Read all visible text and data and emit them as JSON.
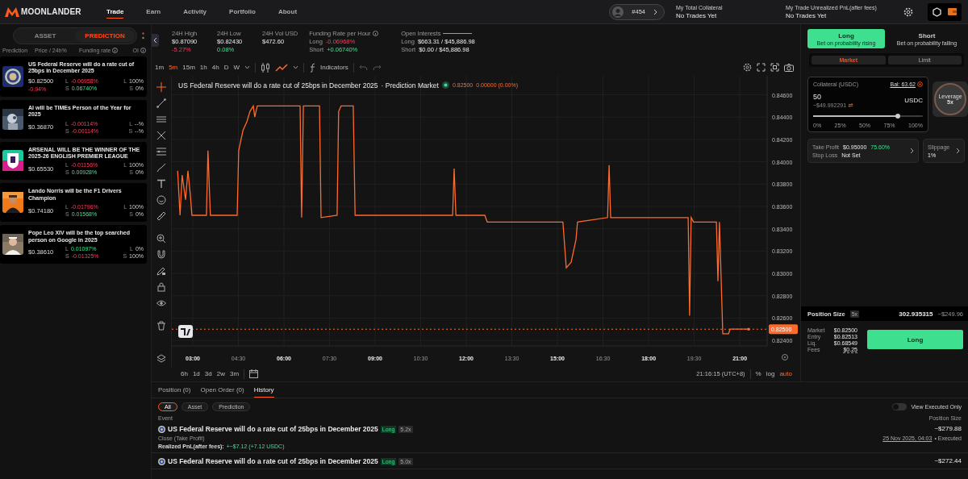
{
  "nav": {
    "logo": "MOONLANDER",
    "links": [
      {
        "label": "Trade",
        "selected": true
      },
      {
        "label": "Earn",
        "selected": false
      },
      {
        "label": "Activity",
        "selected": false
      },
      {
        "label": "Portfolio",
        "selected": false
      },
      {
        "label": "About",
        "selected": false
      }
    ]
  },
  "account": {
    "rank": "#454"
  },
  "summary": [
    {
      "label": "My Total Collateral",
      "value": "No Trades Yet"
    },
    {
      "label": "My Trade Unrealized PnL(after fees)",
      "value": "No Trades Yet"
    }
  ],
  "sidebar": {
    "tabs": [
      {
        "label": "ASSET",
        "selected": false
      },
      {
        "label": "PREDICTION",
        "selected": true
      }
    ],
    "columns": [
      {
        "label": "Prediction",
        "info": false
      },
      {
        "label": "Price / 24h%",
        "info": false
      },
      {
        "label": "Funding rate",
        "info": true
      },
      {
        "label": "OI",
        "info": true
      }
    ],
    "markets": [
      {
        "title": "US Federal Reserve will do a rate cut of 25bps in December 2025",
        "price": "$0.82500",
        "change": {
          "text": "-0.94%",
          "up": false
        },
        "rates": [
          {
            "side": "L",
            "value": "-0.06958%",
            "up": false
          },
          {
            "side": "S",
            "value": "0.06740%",
            "up": true
          }
        ],
        "oi": [
          {
            "side": "L",
            "value": "100%"
          },
          {
            "side": "S",
            "value": "0%"
          }
        ]
      },
      {
        "title": "AI will be TIMEs Person of the Year for 2025",
        "price": "$0.36870",
        "rates": [
          {
            "side": "L",
            "value": "-0.00114%",
            "up": false
          },
          {
            "side": "S",
            "value": "-0.00114%",
            "up": false
          }
        ],
        "oi": [
          {
            "side": "L",
            "value": "--%"
          },
          {
            "side": "S",
            "value": "--%"
          }
        ]
      },
      {
        "title": "ARSENAL WILL BE THE WINNER OF THE 2025-26 ENGLISH PREMIER LEAGUE",
        "price": "$0.65530",
        "rates": [
          {
            "side": "L",
            "value": "-0.01156%",
            "up": false
          },
          {
            "side": "S",
            "value": "0.00928%",
            "up": true
          }
        ],
        "oi": [
          {
            "side": "L",
            "value": "100%"
          },
          {
            "side": "S",
            "value": "0%"
          }
        ]
      },
      {
        "title": "Lando Norris will be the F1 Drivers Champion",
        "price": "$0.74180",
        "rates": [
          {
            "side": "L",
            "value": "-0.01796%",
            "up": false
          },
          {
            "side": "S",
            "value": "0.01568%",
            "up": true
          }
        ],
        "oi": [
          {
            "side": "L",
            "value": "100%"
          },
          {
            "side": "S",
            "value": "0%"
          }
        ]
      },
      {
        "title": "Pope Leo XIV will be the top searched person on Google in 2025",
        "price": "$0.38610",
        "rates": [
          {
            "side": "L",
            "value": "0.01097%",
            "up": true
          },
          {
            "side": "S",
            "value": "-0.01325%",
            "up": false
          }
        ],
        "oi": [
          {
            "side": "L",
            "value": "0%"
          },
          {
            "side": "S",
            "value": "100%"
          }
        ]
      }
    ]
  },
  "stats": [
    {
      "label": "24H High",
      "value": "$0.87090",
      "change": {
        "text": "-5.27%",
        "up": false
      }
    },
    {
      "label": "24H Low",
      "value": "$0.82430",
      "change": {
        "text": "0.08%",
        "up": true
      }
    },
    {
      "label": "24H Vol USD",
      "value": "$472.60"
    }
  ],
  "funding": {
    "label": "Funding Rate per Hour",
    "rows": [
      {
        "side": "Long",
        "value": "-0.06968%",
        "up": false
      },
      {
        "side": "Short",
        "value": "+0.06740%",
        "up": true
      }
    ]
  },
  "open_interest": {
    "label": "Open Interests",
    "level": 1,
    "rows": [
      {
        "side": "Long",
        "value": "$663.31 / $45,886.98"
      },
      {
        "side": "Short",
        "value": "$0.00 / $45,886.98"
      }
    ]
  },
  "intervals": [
    {
      "label": "1m",
      "selected": false
    },
    {
      "label": "5m",
      "selected": true
    },
    {
      "label": "15m",
      "selected": false
    },
    {
      "label": "1h",
      "selected": false
    },
    {
      "label": "4h",
      "selected": false
    },
    {
      "label": "D",
      "selected": false
    },
    {
      "label": "W",
      "selected": false
    }
  ],
  "indicators_label": "Indicators",
  "chart": {
    "title": "US Federal Reserve will do a rate cut of 25bps in December 2025",
    "subtitle": "· Prediction Market",
    "price": "0.82500",
    "change": "0.00000 (0.00%)",
    "chart_data": {
      "type": "line",
      "grid": true,
      "xlim": [
        2.31,
        21.9
      ],
      "ylim": [
        0.8235,
        0.8477
      ],
      "xticks": [
        {
          "value": 3,
          "label": "03:00"
        },
        {
          "value": 4.5,
          "label": "04:30"
        },
        {
          "value": 6,
          "label": "06:00"
        },
        {
          "value": 7.5,
          "label": "07:30"
        },
        {
          "value": 9,
          "label": "09:00"
        },
        {
          "value": 10.5,
          "label": "10:30"
        },
        {
          "value": 12,
          "label": "12:00"
        },
        {
          "value": 13.5,
          "label": "13:30"
        },
        {
          "value": 15,
          "label": "15:00"
        },
        {
          "value": 16.5,
          "label": "16:30"
        },
        {
          "value": 18,
          "label": "18:00"
        },
        {
          "value": 19.5,
          "label": "19:30"
        },
        {
          "value": 21,
          "label": "21:00"
        }
      ],
      "yticks": [
        {
          "value": 0.824,
          "label": "0.82400"
        },
        {
          "value": 0.826,
          "label": "0.82600"
        },
        {
          "value": 0.828,
          "label": "0.82800"
        },
        {
          "value": 0.83,
          "label": "0.83000"
        },
        {
          "value": 0.832,
          "label": "0.83200"
        },
        {
          "value": 0.834,
          "label": "0.83400"
        },
        {
          "value": 0.836,
          "label": "0.83600"
        },
        {
          "value": 0.838,
          "label": "0.83800"
        },
        {
          "value": 0.84,
          "label": "0.84000"
        },
        {
          "value": 0.842,
          "label": "0.84200"
        },
        {
          "value": 0.844,
          "label": "0.84400"
        },
        {
          "value": 0.846,
          "label": "0.84600"
        }
      ],
      "x": [
        2.5,
        2.58,
        2.65,
        2.76,
        2.84,
        2.92,
        2.97,
        3.45,
        3.5,
        3.58,
        4.46,
        4.51,
        4.65,
        4.78,
        4.88,
        4.99,
        5.04,
        5.12,
        6.53,
        6.58,
        6.64,
        7.17,
        7.22,
        7.75,
        7.8,
        7.88,
        8.28,
        8.34,
        11.55,
        11.6,
        11.66,
        12.61,
        12.69,
        15.18,
        15.29,
        15.45,
        15.61,
        15.66,
        16.65,
        16.7,
        16.75,
        19.3,
        19.35,
        19.4,
        19.48,
        20.23,
        20.28,
        20.33,
        20.44,
        20.63,
        20.68,
        21.29
      ],
      "series": [
        {
          "color": "#ff6a2b",
          "values": [
            0.8392,
            0.8352,
            0.8388,
            0.8366,
            0.8392,
            0.837,
            0.8352,
            0.8352,
            0.841,
            0.8352,
            0.8352,
            0.841,
            0.8428,
            0.8436,
            0.8445,
            0.845,
            0.844,
            0.845,
            0.845,
            0.835,
            0.845,
            0.845,
            0.835,
            0.8352,
            0.8445,
            0.845,
            0.845,
            0.8352,
            0.8352,
            0.8394,
            0.8352,
            0.8352,
            0.8346,
            0.8346,
            0.8305,
            0.831,
            0.833,
            0.8346,
            0.835,
            0.8397,
            0.835,
            0.835,
            0.8262,
            0.835,
            0.8346,
            0.8346,
            0.8293,
            0.8346,
            0.8246,
            0.8246,
            0.825,
            0.825
          ]
        }
      ],
      "ref_lines": [
        {
          "axis": "y",
          "value": 0.825,
          "label": "0.82500",
          "color": "#ff6a2b"
        }
      ]
    }
  },
  "ranges": [
    "6h",
    "1d",
    "3d",
    "2w",
    "3m"
  ],
  "clock": "21:16:15 (UTC+8)",
  "scales": [
    {
      "label": "%",
      "selected": false
    },
    {
      "label": "log",
      "selected": false
    },
    {
      "label": "auto",
      "selected": true
    }
  ],
  "order": {
    "sides": [
      {
        "label": "Long",
        "hint": "Bet on probability rising",
        "selected": true
      },
      {
        "label": "Short",
        "hint": "Bet on probability falling",
        "selected": false
      }
    ],
    "types": [
      {
        "label": "Market",
        "selected": true
      },
      {
        "label": "Limit",
        "selected": false
      }
    ],
    "collateral": {
      "label": "Collateral (USDC)",
      "balance": "Bal: 63.62",
      "amount": "50",
      "usd": "~$49.992291",
      "unit": "USDC",
      "level": 0.77,
      "ticks": [
        "0%",
        "25%",
        "50%",
        "75%",
        "100%"
      ]
    },
    "leverage": {
      "label": "Leverage",
      "value": "5x"
    },
    "take_profit": {
      "label": "Take Profit",
      "value": "$0.95000",
      "percent": "75.60%"
    },
    "stop_loss": {
      "label": "Stop Loss",
      "value": "Not Set"
    },
    "slippage": {
      "label": "Slippage",
      "value": "1%"
    },
    "position": {
      "label": "Position Size",
      "leverage": "5x",
      "size": "302.935315",
      "usd": "~$249.96"
    },
    "details": [
      {
        "label": "Market",
        "value": "$0.82500"
      },
      {
        "label": "Entry",
        "value": "$0.82513"
      },
      {
        "label": "Liq.",
        "value": "$0.68549"
      },
      {
        "label": "Fees",
        "value": "$0.25"
      }
    ],
    "submit": "Long"
  },
  "bottom": {
    "tabs": [
      {
        "label": "Position (0)",
        "selected": false
      },
      {
        "label": "Open Order (0)",
        "selected": false
      },
      {
        "label": "History",
        "selected": true
      }
    ],
    "filters": [
      {
        "label": "All",
        "selected": true
      },
      {
        "label": "Asset",
        "selected": false
      },
      {
        "label": "Prediction",
        "selected": false
      }
    ],
    "toggle": {
      "label": "View Executed Only",
      "on": false
    },
    "columns": [
      "Event",
      "Position Size"
    ],
    "rows": [
      {
        "title": "US Federal Reserve will do a rate cut of 25bps in December 2025",
        "side": "Long",
        "leverage": "5.2x",
        "action": "Close (Take Profit)",
        "pnl_label": "Realized PnL(after fees):",
        "pnl": "+~$7.12 (+7.12 USDC)",
        "size": "~$279.88",
        "time": "25 Nov 2025, 04:03",
        "status": "• Executed"
      },
      {
        "title": "US Federal Reserve will do a rate cut of 25bps in December 2025",
        "side": "Long",
        "leverage": "5.0x",
        "size": "~$272.44"
      }
    ]
  }
}
